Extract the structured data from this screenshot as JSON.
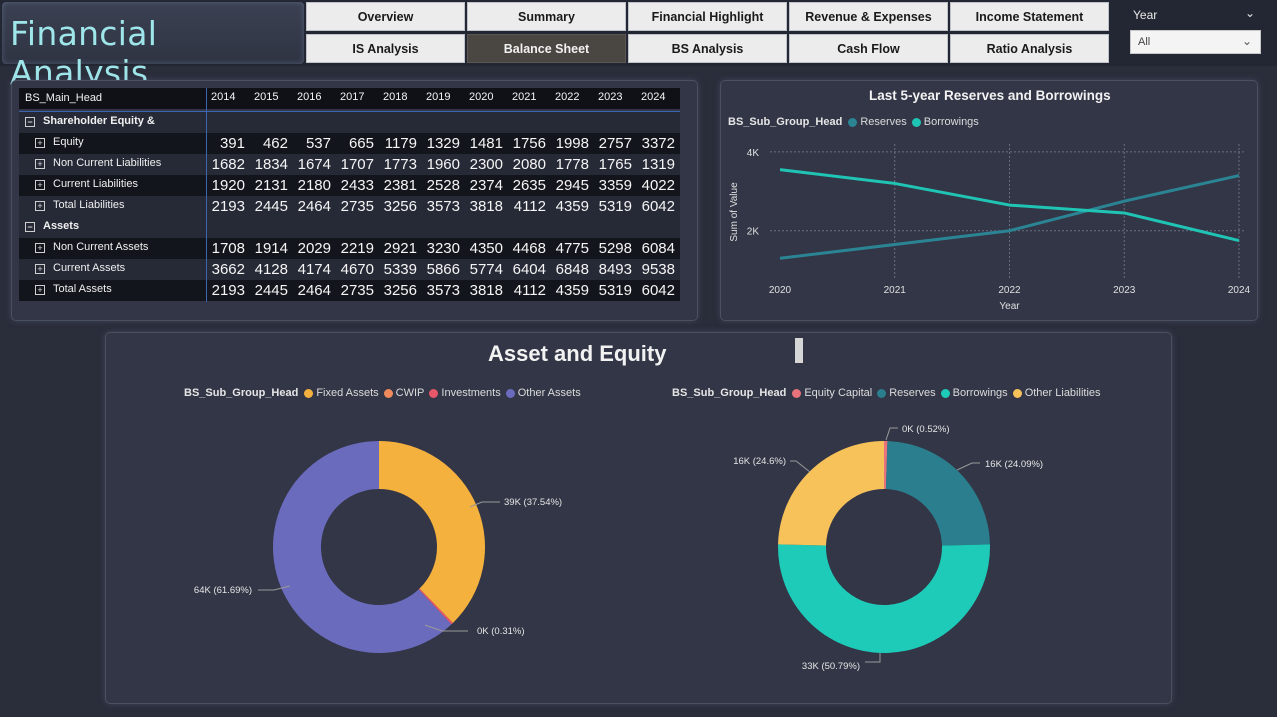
{
  "app": {
    "title": "Financial Analysis"
  },
  "nav": {
    "row1": [
      "Overview",
      "Summary",
      "Financial Highlight",
      "Revenue & Expenses",
      "Income Statement"
    ],
    "row2": [
      "IS Analysis",
      "Balance Sheet",
      "BS Analysis",
      "Cash Flow",
      "Ratio Analysis"
    ],
    "active": "Balance Sheet"
  },
  "filter": {
    "label": "Year",
    "value": "All"
  },
  "table": {
    "header_label": "BS_Main_Head",
    "years": [
      "2014",
      "2015",
      "2016",
      "2017",
      "2018",
      "2019",
      "2020",
      "2021",
      "2022",
      "2023",
      "2024"
    ],
    "groups": [
      {
        "label": "Shareholder Equity & Liabilities",
        "rows": [
          {
            "label": "Equity",
            "values": [
              391,
              462,
              537,
              665,
              1179,
              1329,
              1481,
              1756,
              1998,
              2757,
              3372
            ]
          },
          {
            "label": "Non Current Liabilities",
            "values": [
              1682,
              1834,
              1674,
              1707,
              1773,
              1960,
              2300,
              2080,
              1778,
              1765,
              1319
            ]
          },
          {
            "label": "Current Liabilities",
            "values": [
              1920,
              2131,
              2180,
              2433,
              2381,
              2528,
              2374,
              2635,
              2945,
              3359,
              4022
            ]
          },
          {
            "label": "Total Liabilities",
            "values": [
              2193,
              2445,
              2464,
              2735,
              3256,
              3573,
              3818,
              4112,
              4359,
              5319,
              6042
            ]
          }
        ]
      },
      {
        "label": "Assets",
        "rows": [
          {
            "label": "Non Current Assets",
            "values": [
              1708,
              1914,
              2029,
              2219,
              2921,
              3230,
              4350,
              4468,
              4775,
              5298,
              6084
            ]
          },
          {
            "label": "Current Assets",
            "values": [
              3662,
              4128,
              4174,
              4670,
              5339,
              5866,
              5774,
              6404,
              6848,
              8493,
              9538
            ]
          },
          {
            "label": "Total Assets",
            "values": [
              2193,
              2445,
              2464,
              2735,
              3256,
              3573,
              3818,
              4112,
              4359,
              5319,
              6042
            ]
          }
        ]
      }
    ]
  },
  "chart_data": [
    {
      "type": "line",
      "title": "Last 5-year Reserves and Borrowings",
      "legend_title": "BS_Sub_Group_Head",
      "x": [
        "2020",
        "2021",
        "2022",
        "2023",
        "2024"
      ],
      "xlabel": "Year",
      "ylabel": "Sum of Value",
      "yticks": [
        "2K",
        "4K"
      ],
      "ylim": [
        800,
        4200
      ],
      "grid": true,
      "series": [
        {
          "name": "Reserves",
          "color": "#2b8494",
          "values": [
            1300,
            1650,
            2000,
            2750,
            3400
          ]
        },
        {
          "name": "Borrowings",
          "color": "#20c4b4",
          "values": [
            3550,
            3200,
            2650,
            2450,
            1750
          ]
        }
      ]
    },
    {
      "type": "pie",
      "section_title": "Asset and Equity",
      "legend_title": "BS_Sub_Group_Head",
      "series": [
        {
          "name": "Fixed Assets",
          "color": "#f5b13d",
          "value": 37.54,
          "label": "39K (37.54%)"
        },
        {
          "name": "CWIP",
          "color": "#f08a5d",
          "value": 0.0,
          "label": ""
        },
        {
          "name": "Investments",
          "color": "#e8566a",
          "value": 0.31,
          "label": "0K (0.31%)"
        },
        {
          "name": "Other Assets",
          "color": "#6b6bbd",
          "value": 61.69,
          "label": "64K (61.69%)"
        }
      ]
    },
    {
      "type": "pie",
      "legend_title": "BS_Sub_Group_Head",
      "series": [
        {
          "name": "Equity Capital",
          "color": "#e8737c",
          "value": 0.52,
          "label": "0K (0.52%)"
        },
        {
          "name": "Reserves",
          "color": "#2b7e8e",
          "value": 24.09,
          "label": "16K (24.09%)"
        },
        {
          "name": "Borrowings",
          "color": "#1ecab8",
          "value": 50.79,
          "label": "33K (50.79%)"
        },
        {
          "name": "Other Liabilities",
          "color": "#f7c25a",
          "value": 24.6,
          "label": "16K (24.6%)"
        }
      ]
    }
  ]
}
